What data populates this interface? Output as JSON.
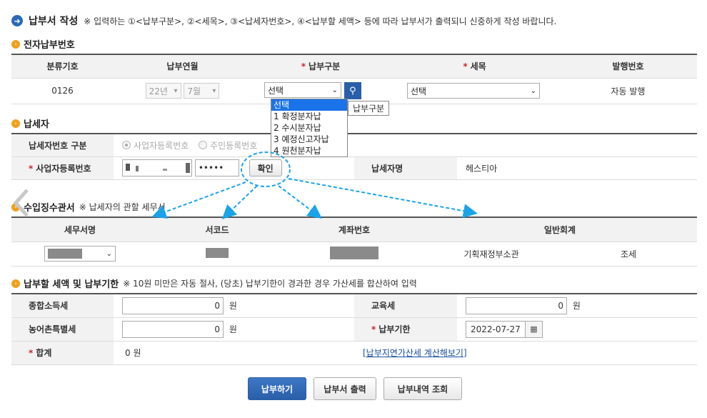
{
  "title": {
    "main": "납부서 작성",
    "note": "※ 입력하는 ①<납부구분>, ②<세목>, ③<납세자번호>, ④<납부할 세액> 등에 따라 납부서가 출력되니 신중하게 작성 바랍니다."
  },
  "section_elec": {
    "title": "전자납부번호",
    "headers": [
      "분류기호",
      "납부연월",
      "납부구분",
      "세목",
      "발행번호"
    ],
    "code": "0126",
    "year": "22년",
    "month": "7월",
    "payment_type_value": "선택",
    "tax_item_value": "선택",
    "issue_no": "자동 발행",
    "tooltip": "납부구분",
    "dropdown_options": [
      "선택",
      "1 확정분자납",
      "2 수시분자납",
      "3 예정신고자납",
      "4 원천분자납"
    ]
  },
  "section_taxpayer": {
    "title": "납세자",
    "id_type_label": "납세자번호 구분",
    "radio_business": "사업자등록번호",
    "radio_resident": "주민등록번호",
    "reg_no_label": "사업자등록번호",
    "masked_value": "•••••",
    "confirm_label": "확인",
    "name_label": "납세자명",
    "name_value": "헤스티아"
  },
  "section_office": {
    "title": "수입징수관서",
    "note": "※ 납세자의 관할 세무서",
    "headers": [
      "세무서명",
      "서코드",
      "계좌번호",
      "일반회계"
    ],
    "account_agency": "기획재정부소관",
    "account_type": "조세"
  },
  "section_amount": {
    "title": "납부할 세액 및 납부기한",
    "note": "※ 10원 미만은 자동 절사, (당초) 납부기한이 경과한 경우 가산세를 합산하여 입력",
    "income_tax_label": "종합소득세",
    "income_tax_value": "0",
    "education_tax_label": "교육세",
    "education_tax_value": "0",
    "rural_tax_label": "농어촌특별세",
    "rural_tax_value": "0",
    "due_date_label": "납부기한",
    "due_date_value": "2022-07-27",
    "total_label": "합계",
    "total_value": "0 원",
    "won": "원",
    "penalty_link": "[납부지연가산세 계산해보기]"
  },
  "buttons": {
    "pay": "납부하기",
    "print": "납부서 출력",
    "history": "납부내역 조회"
  },
  "colors": {
    "primary": "#2a5ea8",
    "required": "#d0242a",
    "section_icon": "#f0a020",
    "arrow": "#1aa3e8"
  }
}
